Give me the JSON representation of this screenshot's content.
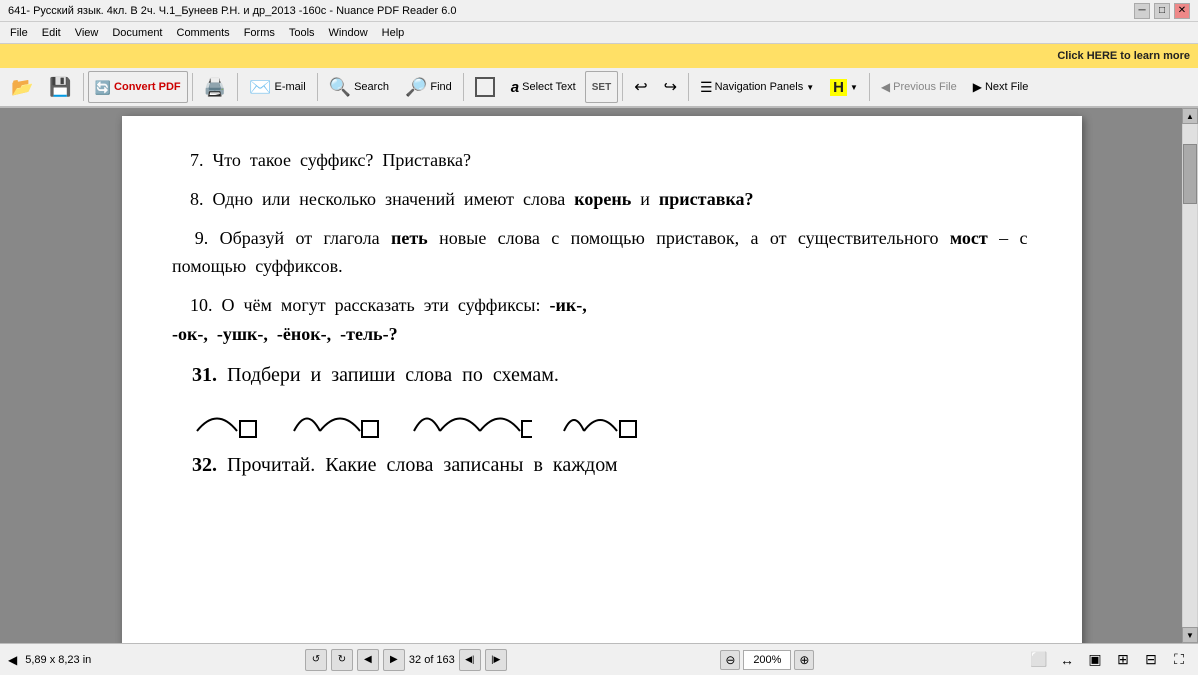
{
  "titleBar": {
    "title": "641- Русский язык. 4кл. В 2ч. Ч.1_Бунеев Р.Н. и др_2013 -160с - Nuance PDF Reader 6.0",
    "minimize": "─",
    "maximize": "□",
    "close": "✕"
  },
  "menuBar": {
    "items": [
      "File",
      "Edit",
      "View",
      "Document",
      "Comments",
      "Forms",
      "Tools",
      "Window",
      "Help"
    ]
  },
  "adBar": {
    "text": "Click HERE to learn more"
  },
  "toolbar": {
    "buttons": [
      {
        "name": "open-folder",
        "icon": "📂",
        "label": ""
      },
      {
        "name": "save",
        "icon": "💾",
        "label": ""
      },
      {
        "name": "convert-pdf",
        "icon": "🔄",
        "label": "Convert PDF"
      },
      {
        "name": "print",
        "icon": "🖨️",
        "label": ""
      },
      {
        "name": "email",
        "icon": "✉️",
        "label": "E-mail"
      },
      {
        "name": "search-toolbar",
        "icon": "🔍",
        "label": "Search"
      },
      {
        "name": "find",
        "icon": "🔎",
        "label": "Find"
      },
      {
        "name": "select-tool",
        "icon": "⬜",
        "label": ""
      },
      {
        "name": "select-text",
        "icon": "A",
        "label": "Select Text"
      },
      {
        "name": "set",
        "icon": "SET",
        "label": ""
      },
      {
        "name": "undo",
        "icon": "↩",
        "label": ""
      },
      {
        "name": "redo",
        "icon": "↪",
        "label": ""
      },
      {
        "name": "nav-panels",
        "icon": "☰",
        "label": "Navigation Panels",
        "dropdown": true
      },
      {
        "name": "highlight",
        "icon": "H",
        "label": "",
        "dropdown": true
      },
      {
        "name": "prev-file",
        "icon": "◀",
        "label": "Previous File",
        "disabled": true
      },
      {
        "name": "next-file",
        "icon": "▶",
        "label": "Next File",
        "disabled": false
      }
    ]
  },
  "content": {
    "paragraphs": [
      {
        "id": "q7",
        "text": "7.  Что  такое  суффикс?  Приставка?"
      },
      {
        "id": "q8",
        "text": "8.  Одно  или  несколько  значений  имеют  слова  корень  и  приставка?"
      },
      {
        "id": "q9",
        "text": "9.  Образуй  от  глагола  петь  новые  слова  с  по­мощью  приставок,  а  от  существительного  мост  –  с  помощью  суффиксов."
      },
      {
        "id": "q10",
        "text": "10.  О  чём  могут  рассказать  эти  суффиксы:  -ик-,  -ок-,  -ушк-,  -ёнок-,  -тель-?"
      },
      {
        "id": "q31",
        "text": "31.  Подбери  и  запиши  слова  по  схемам."
      },
      {
        "id": "q32",
        "text": "32.  Прочитай.  Какие  слова  записаны  в  каждом"
      }
    ],
    "boldWords": {
      "q8_bold1": "корень",
      "q8_bold2": "приставка?",
      "q9_bold1": "петь",
      "q9_bold2": "мост"
    }
  },
  "statusBar": {
    "dimensions": "5,89 x 8,23 in",
    "pageInfo": "32 of 163",
    "zoom": "200%",
    "icons": [
      "rotate-left",
      "rotate-right",
      "prev-page",
      "next-page",
      "first-page",
      "last-page",
      "zoom-out",
      "zoom-in",
      "fit-page",
      "fit-width",
      "two-page",
      "split-view",
      "fullscreen"
    ]
  }
}
